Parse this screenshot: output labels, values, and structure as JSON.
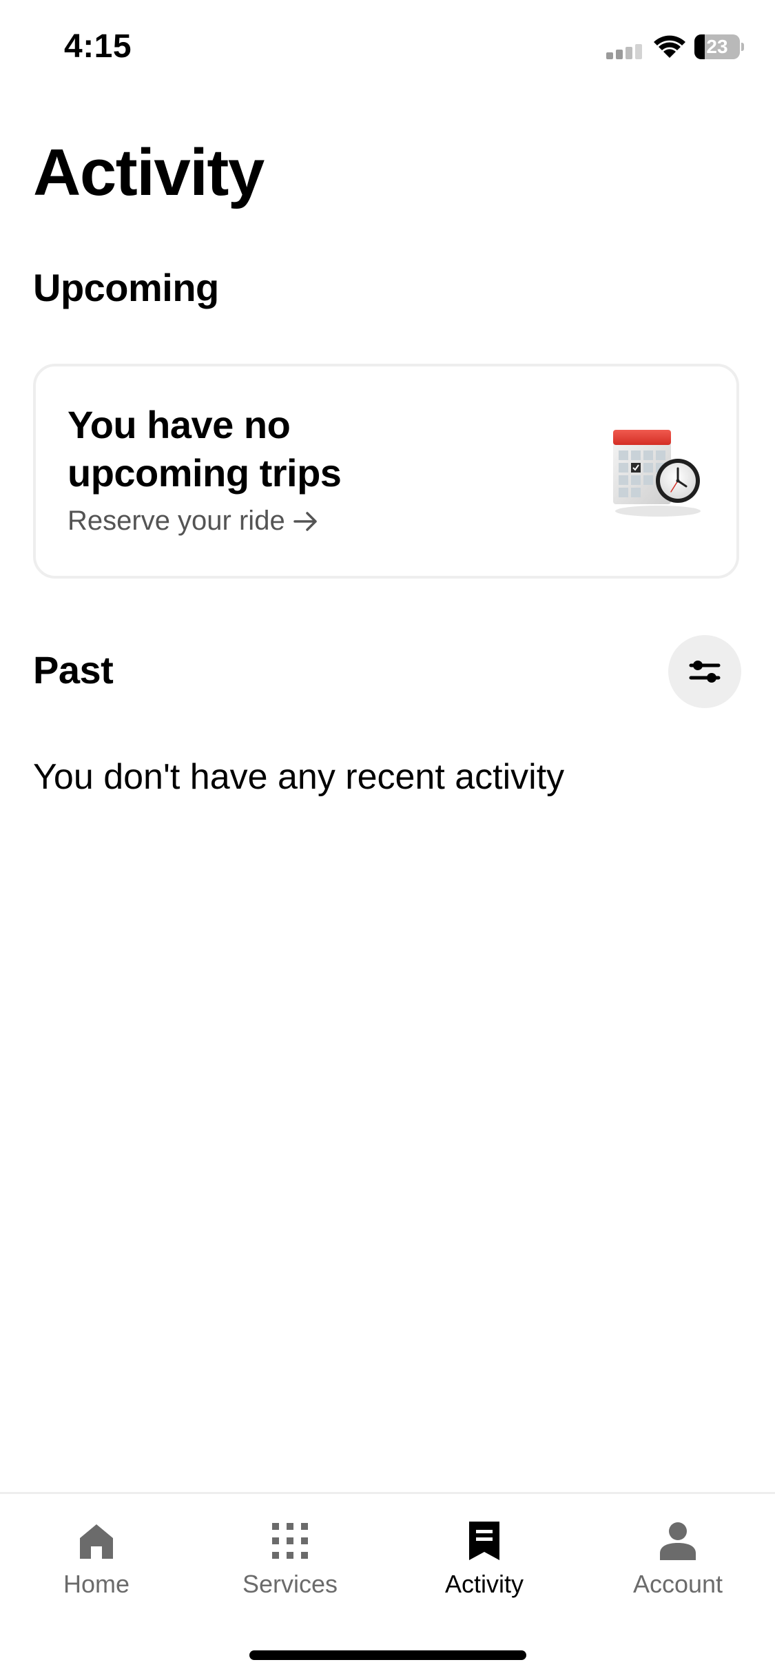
{
  "status_bar": {
    "time": "4:15",
    "battery_level": "23",
    "battery_fraction": 0.23
  },
  "header": {
    "title": "Activity"
  },
  "upcoming": {
    "heading": "Upcoming",
    "card_title": "You have no upcoming trips",
    "reserve_label": "Reserve your ride",
    "illustration": "calendar-clock-icon"
  },
  "past": {
    "heading": "Past",
    "filter_icon": "sliders-icon",
    "empty_message": "You don't have any recent activity"
  },
  "bottom_nav": {
    "items": [
      {
        "label": "Home",
        "icon": "home-icon",
        "active": false
      },
      {
        "label": "Services",
        "icon": "grid-icon",
        "active": false
      },
      {
        "label": "Activity",
        "icon": "receipt-icon",
        "active": true
      },
      {
        "label": "Account",
        "icon": "person-icon",
        "active": false
      }
    ]
  },
  "colors": {
    "text_primary": "#000000",
    "text_secondary": "#545454",
    "nav_inactive": "#6b6b6b",
    "card_border": "#eeeeee",
    "button_bg": "#eeeeee",
    "calendar_header": "#e8392f"
  }
}
